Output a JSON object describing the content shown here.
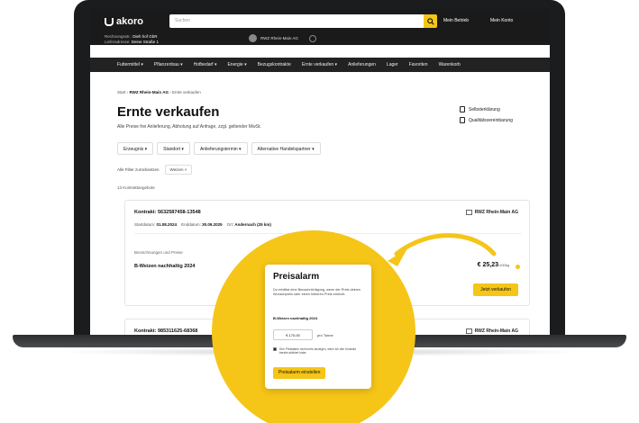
{
  "header": {
    "logo": "akoro",
    "search_placeholder": "Suchen",
    "link_company": "Mein Betrieb",
    "link_account": "Mein Konto",
    "meta_line1_label": "Rechnungsstr.:",
    "meta_line1_value": "Dieh hof GbR",
    "meta_line2_label": "Lieferadresse:",
    "meta_line2_value": "Deine Straße 1",
    "location": "RWZ Rhein-Main AG"
  },
  "nav": {
    "items": [
      "Futtermittel ▾",
      "Pflanzenbau ▾",
      "Hofbedarf ▾",
      "Energie ▾",
      "Bezugskontrakte",
      "Ernte verkaufen ▾",
      "Anlieferungen",
      "Lager",
      "Favoriten",
      "Warenkorb"
    ]
  },
  "page": {
    "breadcrumb_home": "Start",
    "breadcrumb_partner": "RWZ Rhein-Main AG",
    "breadcrumb_current": "Ernte verkaufen",
    "title": "Ernte verkaufen",
    "subtitle": "Alle Preise frei Anlieferung, Abholung auf Anfrage, zzgl. geltender MwSt.",
    "link_declaration": "Selbsterklärung",
    "link_quality": "Qualitätsvereinbarung",
    "filters": [
      "Erzeugnis ▾",
      "Standort ▾",
      "Anlieferungstermin ▾",
      "Alternative Handelspartner ▾"
    ],
    "reset_label": "Alle Filter zurücksetzen",
    "active_filter": "Weizen ×",
    "count_label": "13 Kontraktangebote"
  },
  "contract1": {
    "title": "Kontrakt: 5632587458-13548",
    "partner": "RWZ Rhein-Main AG",
    "start_label": "Startdatum:",
    "start_value": "01.08.2024",
    "end_label": "Enddatum:",
    "end_value": "30.09.2025",
    "place_label": "Ort:",
    "place_value": "Andernach (25 km)",
    "section_label": "Bezeichnungen und Preise",
    "product": "B-Weizen nachhaltig 2024",
    "price": "€ 25,23",
    "price_unit": "/100kg",
    "sell_label": "Jetzt verkaufen"
  },
  "contract2": {
    "title": "Kontrakt: 985311625-68368",
    "partner": "RWZ Rhein-Main AG"
  },
  "price_alarm": {
    "title": "Preisalarm",
    "description": "Du erhältst eine Benachrichtigung, wenn der Preis deinen Wunschpreis oder einen höheren Preis erreicht.",
    "product": "B-Weizen nachhaltig 2024",
    "input_value": "€ 170,00",
    "unit": "pro Tonne",
    "checkbox_text": "Den Preisalarm nicht mehr anzeigen, wenn ich den Kontrakt bereits aktiviert habe.",
    "button_label": "Preisalarm einstellen"
  },
  "colors": {
    "accent": "#f5c518",
    "header_bg": "#1a1a1a",
    "nav_bg": "#222222"
  }
}
